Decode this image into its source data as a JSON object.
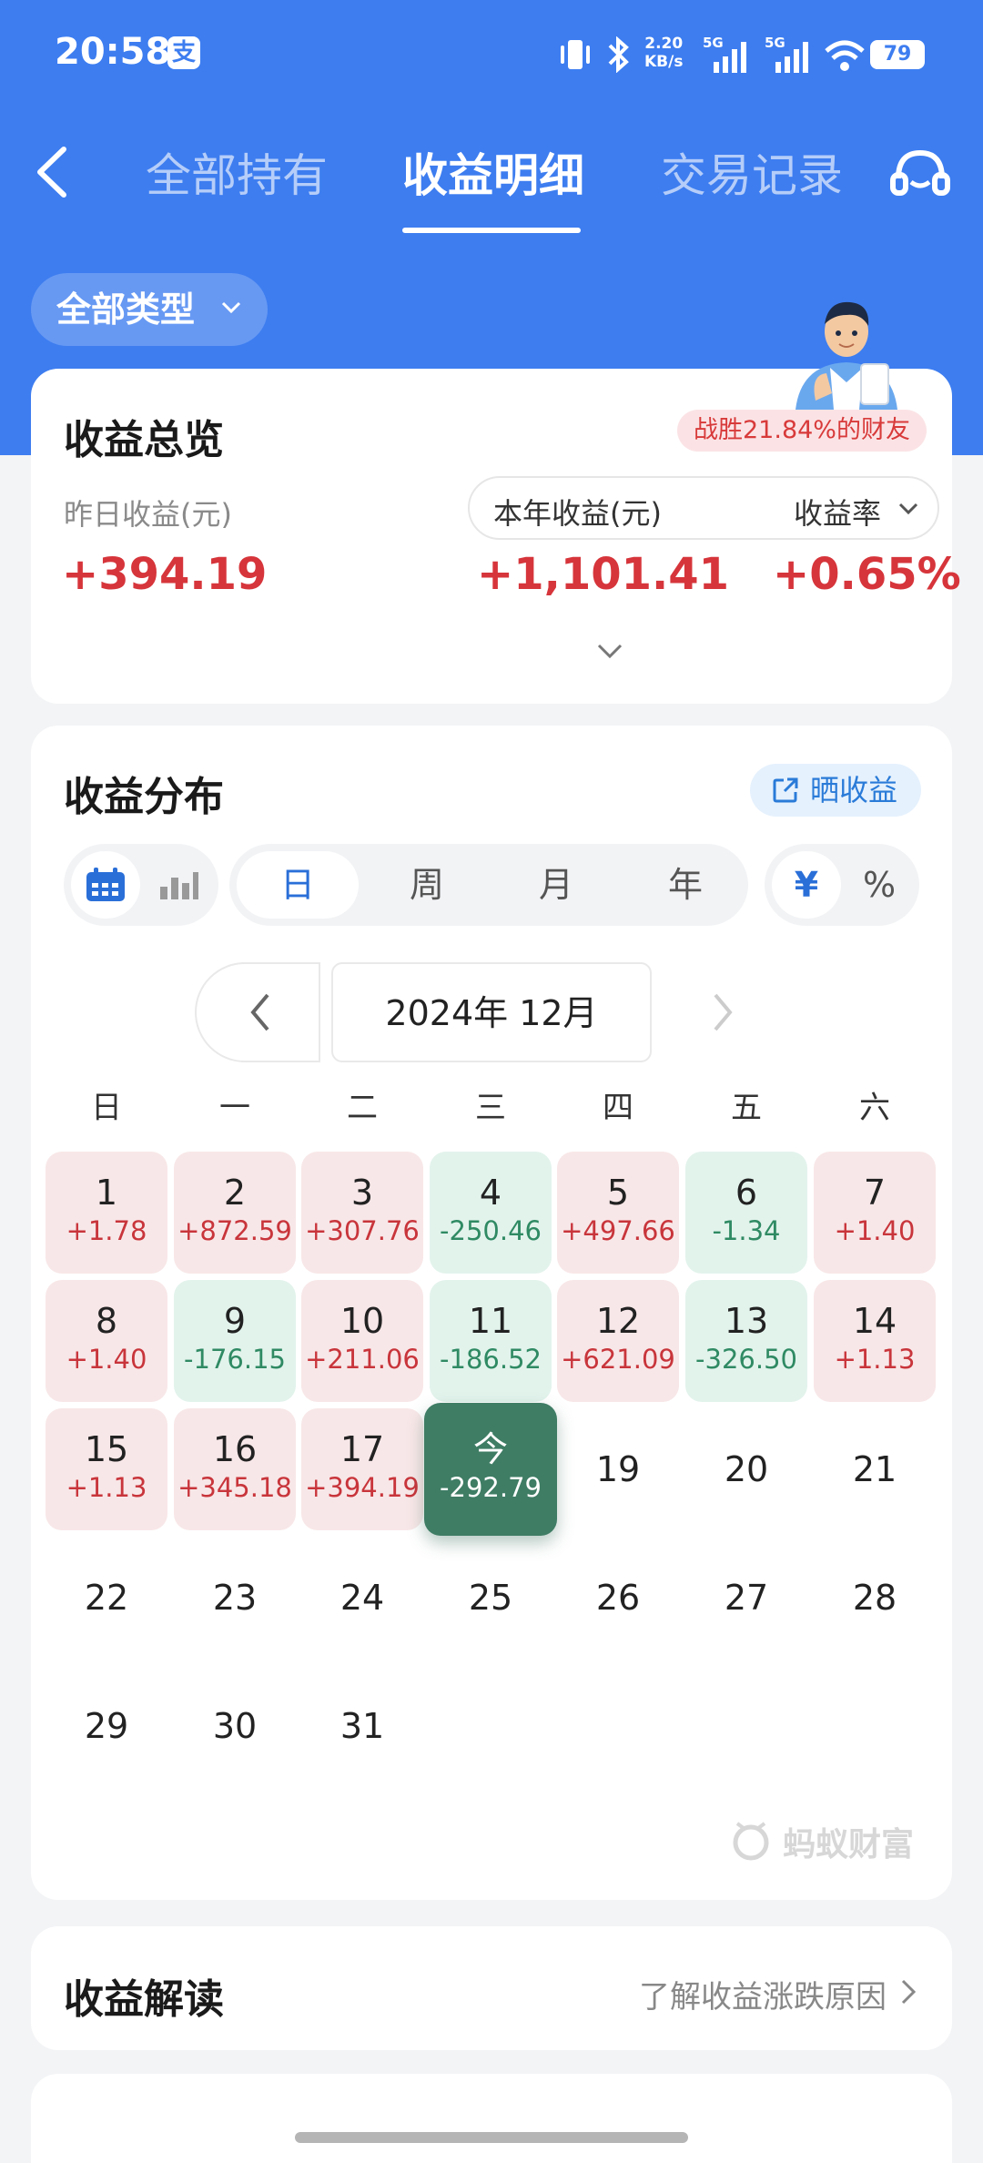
{
  "status_bar": {
    "time": "20:58",
    "pay_icon": "支",
    "net_speed_value": "2.20",
    "net_speed_unit": "KB/s",
    "signal1_label": "5G",
    "signal2_label": "5G",
    "battery": "79"
  },
  "nav": {
    "tabs": [
      {
        "label": "全部持有",
        "active": false
      },
      {
        "label": "收益明细",
        "active": true
      },
      {
        "label": "交易记录",
        "active": false
      }
    ]
  },
  "filter": {
    "label": "全部类型"
  },
  "overview": {
    "title": "收益总览",
    "badge": "战胜21.84%的财友",
    "yesterday_label": "昨日收益(元)",
    "yesterday_value": "+394.19",
    "year_label": "本年收益(元)",
    "year_value": "+1,101.41",
    "rate_label": "收益率",
    "rate_value": "+0.65%"
  },
  "distribution": {
    "title": "收益分布",
    "share_label": "晒收益",
    "period_tabs": [
      {
        "label": "日",
        "active": true
      },
      {
        "label": "周",
        "active": false
      },
      {
        "label": "月",
        "active": false
      },
      {
        "label": "年",
        "active": false
      }
    ],
    "unit_tabs": [
      {
        "label": "¥",
        "active": true
      },
      {
        "label": "%",
        "active": false
      }
    ],
    "month_label": "2024年 12月",
    "weekdays": [
      "日",
      "一",
      "二",
      "三",
      "四",
      "五",
      "六"
    ],
    "days": [
      {
        "day": "1",
        "value": "+1.78",
        "type": "pos"
      },
      {
        "day": "2",
        "value": "+872.59",
        "type": "pos"
      },
      {
        "day": "3",
        "value": "+307.76",
        "type": "pos"
      },
      {
        "day": "4",
        "value": "-250.46",
        "type": "neg"
      },
      {
        "day": "5",
        "value": "+497.66",
        "type": "pos"
      },
      {
        "day": "6",
        "value": "-1.34",
        "type": "neg"
      },
      {
        "day": "7",
        "value": "+1.40",
        "type": "pos"
      },
      {
        "day": "8",
        "value": "+1.40",
        "type": "pos"
      },
      {
        "day": "9",
        "value": "-176.15",
        "type": "neg"
      },
      {
        "day": "10",
        "value": "+211.06",
        "type": "pos"
      },
      {
        "day": "11",
        "value": "-186.52",
        "type": "neg"
      },
      {
        "day": "12",
        "value": "+621.09",
        "type": "pos"
      },
      {
        "day": "13",
        "value": "-326.50",
        "type": "neg"
      },
      {
        "day": "14",
        "value": "+1.13",
        "type": "pos"
      },
      {
        "day": "15",
        "value": "+1.13",
        "type": "pos"
      },
      {
        "day": "16",
        "value": "+345.18",
        "type": "pos"
      },
      {
        "day": "17",
        "value": "+394.19",
        "type": "pos"
      },
      {
        "day": "今",
        "value": "-292.79",
        "type": "today"
      },
      {
        "day": "19",
        "value": "",
        "type": "plain"
      },
      {
        "day": "20",
        "value": "",
        "type": "plain"
      },
      {
        "day": "21",
        "value": "",
        "type": "plain"
      },
      {
        "day": "22",
        "value": "",
        "type": "plain"
      },
      {
        "day": "23",
        "value": "",
        "type": "plain"
      },
      {
        "day": "24",
        "value": "",
        "type": "plain"
      },
      {
        "day": "25",
        "value": "",
        "type": "plain"
      },
      {
        "day": "26",
        "value": "",
        "type": "plain"
      },
      {
        "day": "27",
        "value": "",
        "type": "plain"
      },
      {
        "day": "28",
        "value": "",
        "type": "plain"
      },
      {
        "day": "29",
        "value": "",
        "type": "plain"
      },
      {
        "day": "30",
        "value": "",
        "type": "plain"
      },
      {
        "day": "31",
        "value": "",
        "type": "plain"
      }
    ],
    "watermark": "蚂蚁财富"
  },
  "interpretation": {
    "title": "收益解读",
    "link_label": "了解收益涨跌原因"
  },
  "colors": {
    "brand_blue": "#3d7df0",
    "positive_red": "#d6353b",
    "negative_green": "#2f8a63",
    "today_green": "#3f7d65"
  }
}
